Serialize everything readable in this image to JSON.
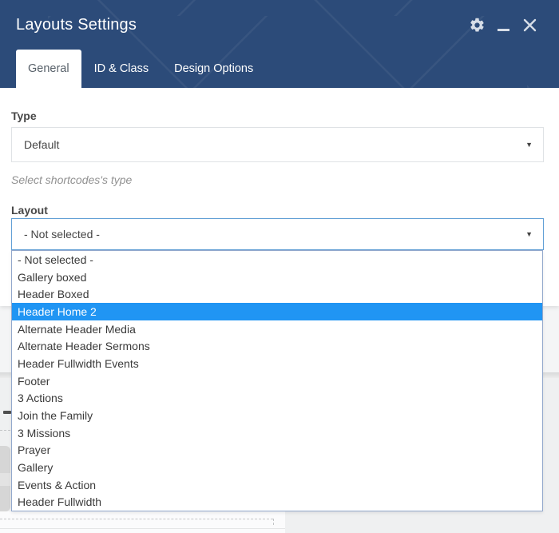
{
  "window": {
    "title": "Layouts Settings"
  },
  "titlebar": {
    "icons": [
      "gear-icon",
      "minimize-icon",
      "close-icon"
    ]
  },
  "tabs": [
    {
      "label": "General",
      "active": true
    },
    {
      "label": "ID & Class",
      "active": false
    },
    {
      "label": "Design Options",
      "active": false
    }
  ],
  "form": {
    "type_label": "Type",
    "type_value": "Default",
    "type_help": "Select shortcodes's type",
    "layout_label": "Layout",
    "layout_value": "- Not selected -"
  },
  "dropdown": {
    "selected": "Header Home 2",
    "selected_index": 3,
    "options": [
      "- Not selected -",
      "Gallery boxed",
      "Header Boxed",
      "Header Home 2",
      "Alternate Header Media",
      "Alternate Header Sermons",
      "Header Fullwidth Events",
      "Footer",
      "3 Actions",
      "Join the Family",
      "3 Missions",
      "Prayer",
      "Gallery",
      "Events & Action",
      "Header Fullwidth"
    ]
  },
  "icons": {
    "select_arrow": "▼"
  },
  "colors": {
    "header_bg": "#2c4b79",
    "highlight_blue": "#2095f3",
    "focus_border": "#62a0d6",
    "page_bg": "#eff0f1"
  }
}
